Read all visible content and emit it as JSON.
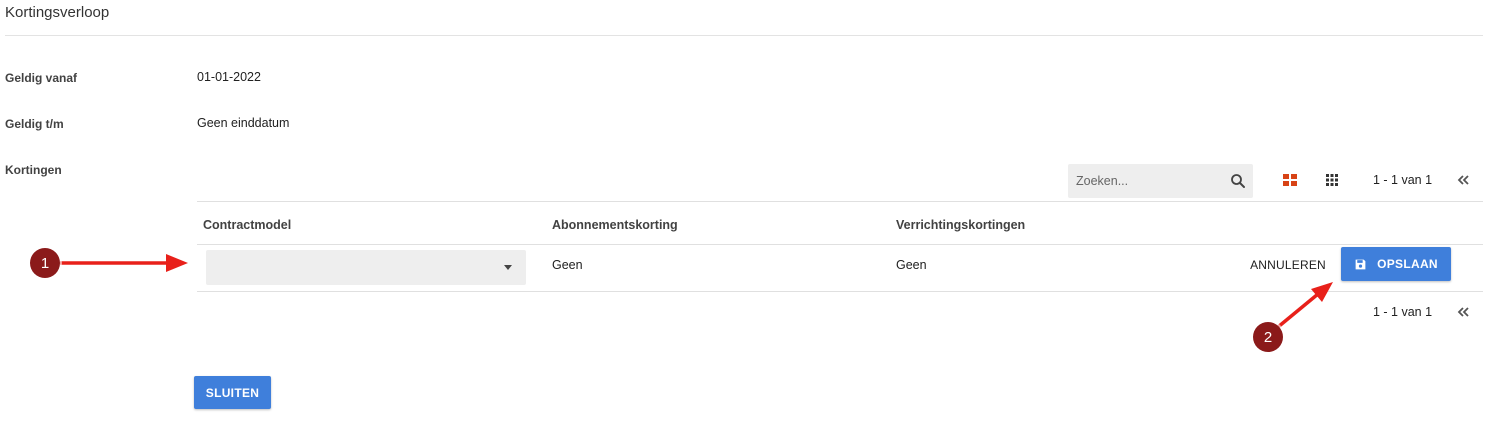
{
  "page": {
    "title": "Kortingsverloop"
  },
  "fields": {
    "valid_from": {
      "label": "Geldig vanaf",
      "value": "01-01-2022"
    },
    "valid_until": {
      "label": "Geldig t/m",
      "value": "Geen einddatum"
    },
    "discounts": {
      "label": "Kortingen"
    }
  },
  "toolbar": {
    "search_placeholder": "Zoeken...",
    "icons": [
      "search-icon",
      "card-view-icon",
      "grid-view-icon",
      "first-page-icon"
    ],
    "pager_top": "1 - 1 van 1"
  },
  "table": {
    "columns": [
      "Contractmodel",
      "Abonnementskorting",
      "Verrichtingskortingen"
    ],
    "rows": [
      {
        "contractmodel": "",
        "subscription_discount": "Geen",
        "transaction_discounts": "Geen"
      }
    ],
    "cancel_label": "ANNULEREN",
    "save_label": "OPSLAAN",
    "pager_bottom": "1 - 1 van 1"
  },
  "footer": {
    "close_label": "SLUITEN"
  },
  "annotations": {
    "marker_1": "1",
    "marker_2": "2"
  },
  "colors": {
    "primary": "#3f7fdb",
    "card_view_active": "#d84315",
    "badge": "#8b1a1a",
    "arrow": "#e8201a"
  }
}
